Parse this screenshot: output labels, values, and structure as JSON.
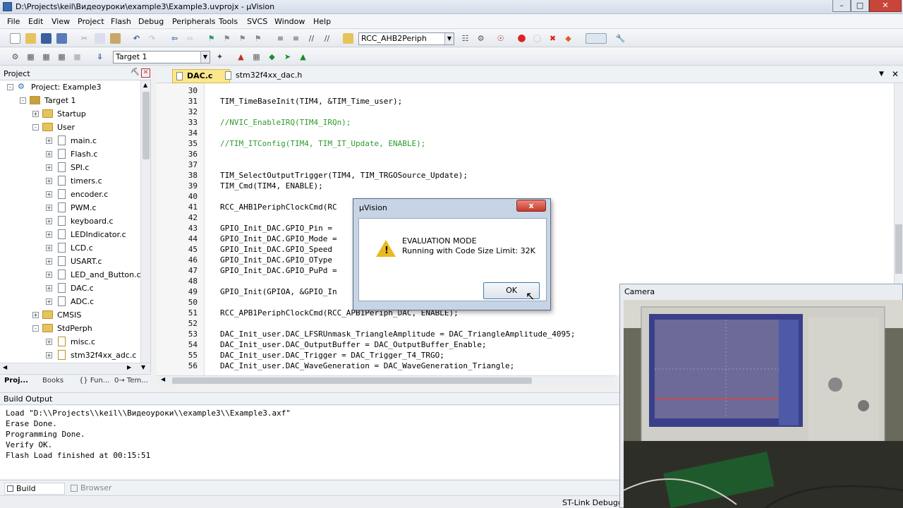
{
  "window": {
    "title": "D:\\Projects\\keil\\Видеоуроки\\example3\\Example3.uvprojx - µVision"
  },
  "menu": [
    "File",
    "Edit",
    "View",
    "Project",
    "Flash",
    "Debug",
    "Peripherals",
    "Tools",
    "SVCS",
    "Window",
    "Help"
  ],
  "toolbar": {
    "target_combo": "RCC_AHB2Periph",
    "build_target": "Target 1"
  },
  "project": {
    "header": "Project",
    "tree": [
      {
        "label": "Project: Example3",
        "level": 0,
        "kind": "root"
      },
      {
        "label": "Target 1",
        "level": 1,
        "kind": "target"
      },
      {
        "label": "Startup",
        "level": 2,
        "kind": "folder",
        "exp": "+"
      },
      {
        "label": "User",
        "level": 2,
        "kind": "folder",
        "exp": "-"
      },
      {
        "label": "main.c",
        "level": 3,
        "kind": "file"
      },
      {
        "label": "Flash.c",
        "level": 3,
        "kind": "file"
      },
      {
        "label": "SPI.c",
        "level": 3,
        "kind": "file"
      },
      {
        "label": "timers.c",
        "level": 3,
        "kind": "file"
      },
      {
        "label": "encoder.c",
        "level": 3,
        "kind": "file"
      },
      {
        "label": "PWM.c",
        "level": 3,
        "kind": "file"
      },
      {
        "label": "keyboard.c",
        "level": 3,
        "kind": "file"
      },
      {
        "label": "LEDIndicator.c",
        "level": 3,
        "kind": "file"
      },
      {
        "label": "LCD.c",
        "level": 3,
        "kind": "file"
      },
      {
        "label": "USART.c",
        "level": 3,
        "kind": "file"
      },
      {
        "label": "LED_and_Button.c",
        "level": 3,
        "kind": "file"
      },
      {
        "label": "DAC.c",
        "level": 3,
        "kind": "file"
      },
      {
        "label": "ADC.c",
        "level": 3,
        "kind": "file"
      },
      {
        "label": "CMSIS",
        "level": 2,
        "kind": "folder",
        "exp": "+"
      },
      {
        "label": "StdPerph",
        "level": 2,
        "kind": "folder",
        "exp": "-"
      },
      {
        "label": "misc.c",
        "level": 3,
        "kind": "file"
      },
      {
        "label": "stm32f4xx_adc.c",
        "level": 3,
        "kind": "file"
      }
    ],
    "tabs": [
      "Proj...",
      "Books",
      "{} Fun...",
      "0→ Tem..."
    ]
  },
  "editor": {
    "tabs": [
      "DAC.c",
      "stm32f4xx_dac.h"
    ],
    "lines": [
      {
        "n": "30",
        "t": "",
        "c": false
      },
      {
        "n": "31",
        "t": "TIM_TimeBaseInit(TIM4, &TIM_Time_user);",
        "c": false
      },
      {
        "n": "32",
        "t": "",
        "c": false
      },
      {
        "n": "33",
        "t": "//NVIC_EnableIRQ(TIM4_IRQn);",
        "c": true
      },
      {
        "n": "34",
        "t": "",
        "c": false
      },
      {
        "n": "35",
        "t": "//TIM_ITConfig(TIM4, TIM_IT_Update, ENABLE);",
        "c": true
      },
      {
        "n": "36",
        "t": "",
        "c": false
      },
      {
        "n": "37",
        "t": "",
        "c": false
      },
      {
        "n": "38",
        "t": "TIM_SelectOutputTrigger(TIM4, TIM_TRGOSource_Update);",
        "c": false
      },
      {
        "n": "39",
        "t": "TIM_Cmd(TIM4, ENABLE);",
        "c": false
      },
      {
        "n": "40",
        "t": "",
        "c": false
      },
      {
        "n": "41",
        "t": "RCC_AHB1PeriphClockCmd(RC",
        "c": false
      },
      {
        "n": "42",
        "t": "",
        "c": false
      },
      {
        "n": "43",
        "t": "GPIO_Init_DAC.GPIO_Pin =",
        "c": false
      },
      {
        "n": "44",
        "t": "GPIO_Init_DAC.GPIO_Mode =",
        "c": false
      },
      {
        "n": "45",
        "t": "GPIO_Init_DAC.GPIO_Speed",
        "c": false
      },
      {
        "n": "46",
        "t": "GPIO_Init_DAC.GPIO_OType",
        "c": false
      },
      {
        "n": "47",
        "t": "GPIO_Init_DAC.GPIO_PuPd =",
        "c": false
      },
      {
        "n": "48",
        "t": "",
        "c": false
      },
      {
        "n": "49",
        "t": "GPIO_Init(GPIOA, &GPIO_In",
        "c": false
      },
      {
        "n": "50",
        "t": "",
        "c": false
      },
      {
        "n": "51",
        "t": "RCC_APB1PeriphClockCmd(RCC_APB1Periph_DAC, ENABLE);",
        "c": false
      },
      {
        "n": "52",
        "t": "",
        "c": false
      },
      {
        "n": "53",
        "t": "DAC_Init_user.DAC_LFSRUnmask_TriangleAmplitude = DAC_TriangleAmplitude_4095;",
        "c": false
      },
      {
        "n": "54",
        "t": "DAC_Init_user.DAC_OutputBuffer = DAC_OutputBuffer_Enable;",
        "c": false
      },
      {
        "n": "55",
        "t": "DAC_Init_user.DAC_Trigger = DAC_Trigger_T4_TRGO;",
        "c": false
      },
      {
        "n": "56",
        "t": "DAC_Init_user.DAC_WaveGeneration = DAC_WaveGeneration_Triangle;",
        "c": false
      }
    ]
  },
  "build": {
    "header": "Build Output",
    "lines": [
      "Load \"D:\\\\Projects\\\\keil\\\\Видеоуроки\\\\example3\\\\Example3.axf\"",
      "Erase Done.",
      "Programming Done.",
      "Verify OK.",
      "Flash Load finished at 00:15:51"
    ],
    "tabs": [
      "Build Output",
      "Browser"
    ]
  },
  "status": {
    "debugger": "ST-Link Debugge"
  },
  "dialog": {
    "title": "µVision",
    "heading": "EVALUATION MODE",
    "message": "Running with Code Size Limit: 32K",
    "ok": "OK",
    "close": "x"
  },
  "camera": {
    "title": "Camera"
  }
}
